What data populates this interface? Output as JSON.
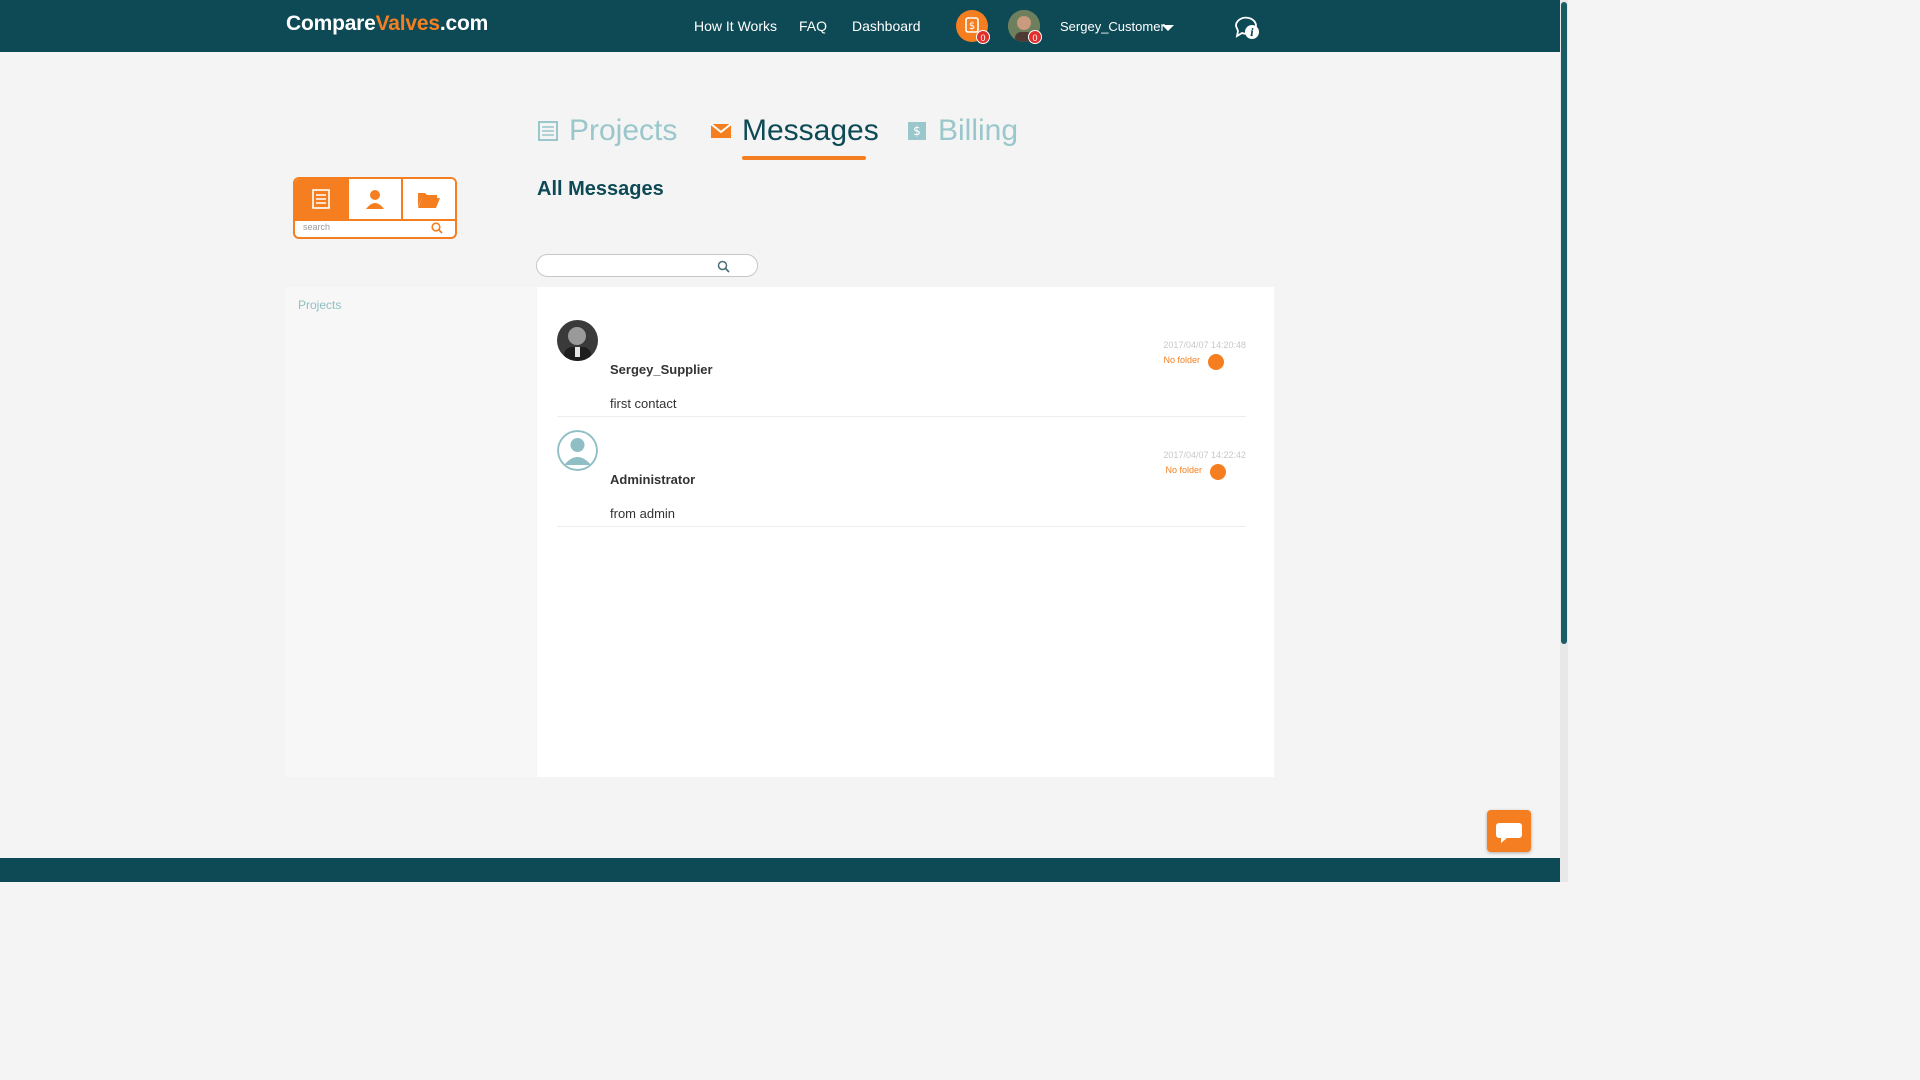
{
  "header": {
    "logo_part1": "Compare",
    "logo_part2": "Valves",
    "logo_part3": ".com",
    "nav": [
      "How It Works",
      "FAQ",
      "Dashboard"
    ],
    "billing_count": "0",
    "profile_count": "0",
    "username": "Sergey_Customer"
  },
  "tabs": [
    {
      "label": "Projects",
      "icon": "list-icon",
      "active": false
    },
    {
      "label": "Messages",
      "icon": "envelope-icon",
      "active": true
    },
    {
      "label": "Billing",
      "icon": "billing-icon",
      "active": false
    }
  ],
  "widget": {
    "search_placeholder": "search"
  },
  "page_title": "All Messages",
  "sidebar": {
    "label": "Projects"
  },
  "messages": [
    {
      "sender": "Sergey_Supplier",
      "body": "first contact",
      "date": "2017/04/07 14:20:48",
      "folder": "No folder"
    },
    {
      "sender": "Administrator",
      "body": "from admin",
      "date": "2017/04/07 14:22:42",
      "folder": "No folder"
    }
  ],
  "colors": {
    "brand_dark": "#0e4a55",
    "accent": "#f57f20",
    "inactive_tab": "#9ac7cb"
  }
}
